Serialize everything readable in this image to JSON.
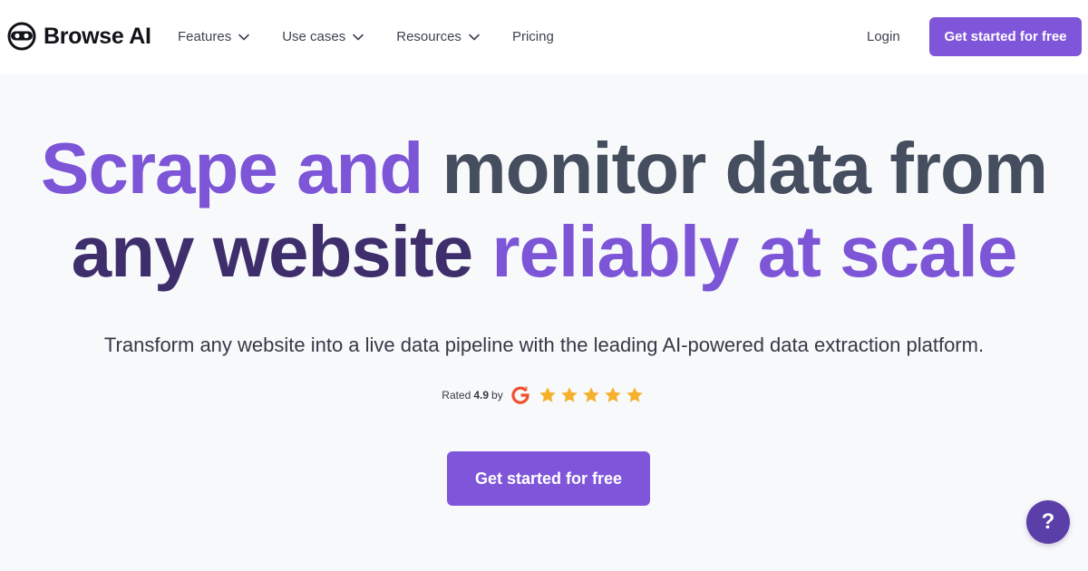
{
  "brand": {
    "name": "Browse AI",
    "logo_icon": "robot-face-icon"
  },
  "nav": {
    "items": [
      {
        "label": "Features",
        "has_dropdown": true
      },
      {
        "label": "Use cases",
        "has_dropdown": true
      },
      {
        "label": "Resources",
        "has_dropdown": true
      },
      {
        "label": "Pricing",
        "has_dropdown": false
      }
    ],
    "login_label": "Login",
    "cta_label": "Get started for free"
  },
  "hero": {
    "title_line1": [
      {
        "text": "Scrape",
        "tone": "purple"
      },
      {
        "text": "and",
        "tone": "purple"
      },
      {
        "text": "monitor",
        "tone": "slate"
      },
      {
        "text": "data",
        "tone": "slate"
      },
      {
        "text": "from",
        "tone": "slate"
      }
    ],
    "title_line2": [
      {
        "text": "any",
        "tone": "deep"
      },
      {
        "text": "website",
        "tone": "deep"
      },
      {
        "text": "reliably",
        "tone": "purple"
      },
      {
        "text": "at",
        "tone": "purple"
      },
      {
        "text": "scale",
        "tone": "purple"
      }
    ],
    "subtitle": "Transform any website into a live data pipeline with the leading AI-powered data extraction platform.",
    "rating": {
      "prefix": "Rated",
      "score": "4.9",
      "by": "by",
      "source_icon": "g2-logo-icon",
      "stars": 5
    },
    "cta_label": "Get started for free"
  },
  "help": {
    "label": "?"
  },
  "colors": {
    "accent": "#7f56d9",
    "title_purple": "#7d55d7",
    "title_slate": "#454e5e",
    "title_deep": "#3e2f6c",
    "star": "#f6b12c",
    "g2": "#f0502f",
    "help_bg": "#5b3fa8"
  }
}
